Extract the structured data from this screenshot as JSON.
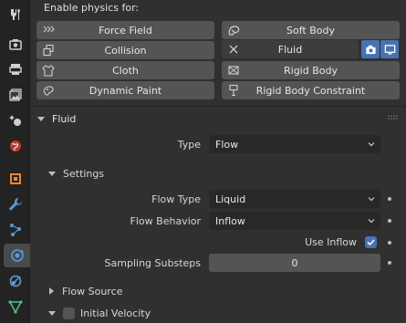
{
  "tabs": [
    "tool-icon",
    "render-icon",
    "output-icon",
    "view-layer-icon",
    "scene-icon",
    "world-icon",
    "object-icon",
    "modifier-icon",
    "particles-icon",
    "physics-icon",
    "constraints-icon",
    "data-icon"
  ],
  "physics": {
    "header": "Enable physics for:",
    "buttons": {
      "force_field": "Force Field",
      "soft_body": "Soft Body",
      "collision": "Collision",
      "fluid": "Fluid",
      "cloth": "Cloth",
      "rigid_body": "Rigid Body",
      "dynamic_paint": "Dynamic Paint",
      "rigid_body_constraint": "Rigid Body Constraint"
    }
  },
  "fluid_panel": {
    "title": "Fluid",
    "type_label": "Type",
    "type_value": "Flow"
  },
  "settings": {
    "title": "Settings",
    "flow_type_label": "Flow Type",
    "flow_type_value": "Liquid",
    "flow_behavior_label": "Flow Behavior",
    "flow_behavior_value": "Inflow",
    "use_inflow_label": "Use Inflow",
    "use_inflow_checked": true,
    "sampling_label": "Sampling Substeps",
    "sampling_value": "0"
  },
  "subpanels": {
    "flow_source": "Flow Source",
    "initial_velocity": "Initial Velocity"
  },
  "colors": {
    "accent": "#4772b3",
    "panel_bg": "#303030",
    "button_bg": "#545454",
    "field_bg": "#282828"
  }
}
